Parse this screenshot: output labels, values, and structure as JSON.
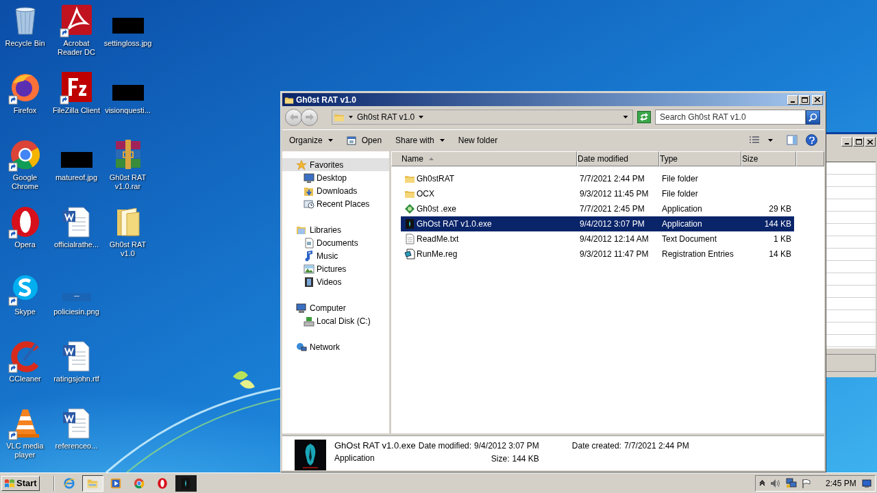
{
  "desktop": {
    "columns": [
      {
        "icons": [
          {
            "label": "Recycle Bin",
            "kind": "recycle_bin",
            "shortcut": false
          },
          {
            "label": "Firefox",
            "kind": "firefox",
            "shortcut": true
          },
          {
            "label": "Google Chrome",
            "kind": "chrome",
            "shortcut": true
          },
          {
            "label": "Opera",
            "kind": "opera",
            "shortcut": true
          },
          {
            "label": "Skype",
            "kind": "skype",
            "shortcut": true
          },
          {
            "label": "CCleaner",
            "kind": "ccleaner",
            "shortcut": true
          },
          {
            "label": "VLC media player",
            "kind": "vlc",
            "shortcut": true
          }
        ]
      },
      {
        "icons": [
          {
            "label": "Acrobat Reader DC",
            "kind": "acrobat",
            "shortcut": true
          },
          {
            "label": "FileZilla Client",
            "kind": "filezilla",
            "shortcut": true
          },
          {
            "label": "matureof.jpg",
            "kind": "redacted",
            "shortcut": false
          },
          {
            "label": "officialrathe...",
            "kind": "word",
            "shortcut": false
          },
          {
            "label": "policiesin.png",
            "kind": "png",
            "shortcut": false
          },
          {
            "label": "ratingsjohn.rtf",
            "kind": "word",
            "shortcut": false
          },
          {
            "label": "referenceo...",
            "kind": "word",
            "shortcut": false
          }
        ]
      },
      {
        "icons": [
          {
            "label": "settingloss.jpg",
            "kind": "redacted",
            "shortcut": false
          },
          {
            "label": "visionquesti...",
            "kind": "redacted",
            "shortcut": false
          },
          {
            "label": "Gh0st RAT v1.0.rar",
            "kind": "winrar",
            "shortcut": false
          },
          {
            "label": "Gh0st RAT v1.0",
            "kind": "folder",
            "shortcut": false
          }
        ]
      }
    ]
  },
  "explorer": {
    "title": "Gh0st RAT v1.0",
    "address": "Gh0st RAT v1.0",
    "search": {
      "placeholder": "Search Gh0st RAT v1.0"
    },
    "toolbar": [
      {
        "label": "Organize",
        "kind": "menu"
      },
      {
        "label": "Open",
        "kind": "icon_button"
      },
      {
        "label": "Share with",
        "kind": "menu"
      },
      {
        "label": "New folder",
        "kind": "plain"
      }
    ],
    "nav": [
      {
        "label": "Favorites",
        "kind": "star",
        "selected": true,
        "children": [
          {
            "label": "Desktop",
            "kind": "desktop",
            "selected": false
          },
          {
            "label": "Downloads",
            "kind": "downloads",
            "selected": false
          },
          {
            "label": "Recent Places",
            "kind": "recent",
            "selected": false
          }
        ]
      },
      {
        "label": "Libraries",
        "kind": "libraries",
        "selected": false,
        "children": [
          {
            "label": "Documents",
            "kind": "documents",
            "selected": false
          },
          {
            "label": "Music",
            "kind": "music",
            "selected": false
          },
          {
            "label": "Pictures",
            "kind": "pictures",
            "selected": false
          },
          {
            "label": "Videos",
            "kind": "videos",
            "selected": false
          }
        ]
      },
      {
        "label": "Computer",
        "kind": "computer",
        "selected": false,
        "children": [
          {
            "label": "Local Disk (C:)",
            "kind": "disk",
            "selected": false
          }
        ]
      },
      {
        "label": "Network",
        "kind": "network",
        "selected": false
      }
    ],
    "columns": [
      {
        "label": "Name",
        "sorted": true
      },
      {
        "label": "Date modified",
        "sorted": false
      },
      {
        "label": "Type",
        "sorted": false
      },
      {
        "label": "Size",
        "sorted": false
      }
    ],
    "rows": [
      {
        "name": "Gh0stRAT",
        "date": "7/7/2021 2:44 PM",
        "type": "File folder",
        "kind": "folder",
        "selected": false
      },
      {
        "name": "OCX",
        "date": "9/3/2012 11:45 PM",
        "type": "File folder",
        "kind": "folder",
        "selected": false
      },
      {
        "name": "Gh0st .exe",
        "date": "7/7/2021 2:45 PM",
        "type": "Application",
        "size": "29 KB",
        "kind": "exe_green",
        "selected": false
      },
      {
        "name": "GhOst RAT v1.0.exe",
        "date": "9/4/2012 3:07 PM",
        "type": "Application",
        "size": "144 KB",
        "kind": "exe_dark",
        "selected": true
      },
      {
        "name": "ReadMe.txt",
        "date": "9/4/2012 12:14 AM",
        "type": "Text Document",
        "size": "1 KB",
        "kind": "text",
        "selected": false
      },
      {
        "name": "RunMe.reg",
        "date": "9/3/2012 11:47 PM",
        "type": "Registration Entries",
        "size": "14 KB",
        "kind": "reg",
        "selected": false
      }
    ],
    "details": {
      "name": "GhOst RAT v1.0.exe",
      "type": "Application",
      "fields": [
        {
          "label": "Date modified:",
          "value": "9/4/2012 3:07 PM"
        },
        {
          "label": "Date created:",
          "value": "7/7/2021 2:44 PM"
        },
        {
          "label": "Size:",
          "value": "144 KB"
        }
      ]
    }
  },
  "taskbar": {
    "start": "Start",
    "apps": [
      {
        "kind": "ie",
        "active": false
      },
      {
        "kind": "explorer",
        "active": true
      },
      {
        "kind": "media",
        "active": false
      },
      {
        "kind": "chrome",
        "active": false
      },
      {
        "kind": "opera",
        "active": false
      },
      {
        "kind": "ghost",
        "active": false
      }
    ],
    "clock": "2:45 PM"
  }
}
